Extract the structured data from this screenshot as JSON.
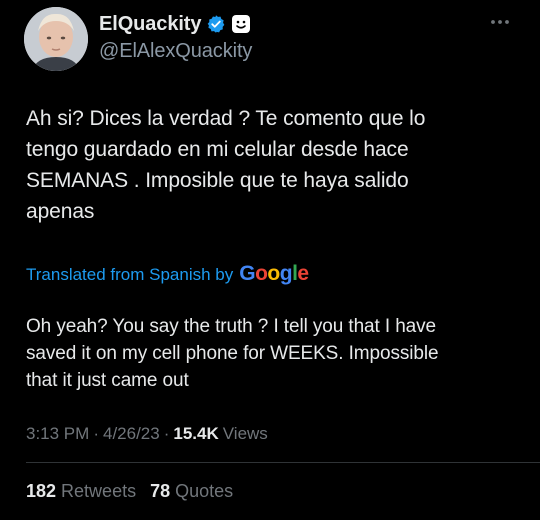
{
  "author": {
    "display_name": "ElQuackity",
    "handle": "@ElAlexQuackity",
    "verified": true,
    "avatar_icon": "profile-photo"
  },
  "tweet": {
    "text": "Ah si? Dices la verdad ? Te comento que lo\ntengo guardado en mi celular desde hace\nSEMANAS . Imposible que te haya salido\napenas",
    "translation_label": "Translated from Spanish by",
    "translation_provider": "Google",
    "translated_text": "Oh yeah? You say the truth ? I tell you that I have\nsaved it on my cell phone for WEEKS. Impossible\nthat it just came out",
    "time": "3:13 PM",
    "date": "4/26/23",
    "views_count": "15.4K",
    "views_label": "Views"
  },
  "stats": {
    "retweets_count": "182",
    "retweets_label": "Retweets",
    "quotes_count": "78",
    "quotes_label": "Quotes"
  },
  "icons": {
    "verified": "verified-badge-icon",
    "emoji": "smiley-emoji-icon",
    "more": "more-options-icon"
  },
  "colors": {
    "background": "#000000",
    "text_primary": "#e7e9ea",
    "text_secondary": "#71767b",
    "link_blue": "#1d9bf0",
    "divider": "#2f3336"
  }
}
